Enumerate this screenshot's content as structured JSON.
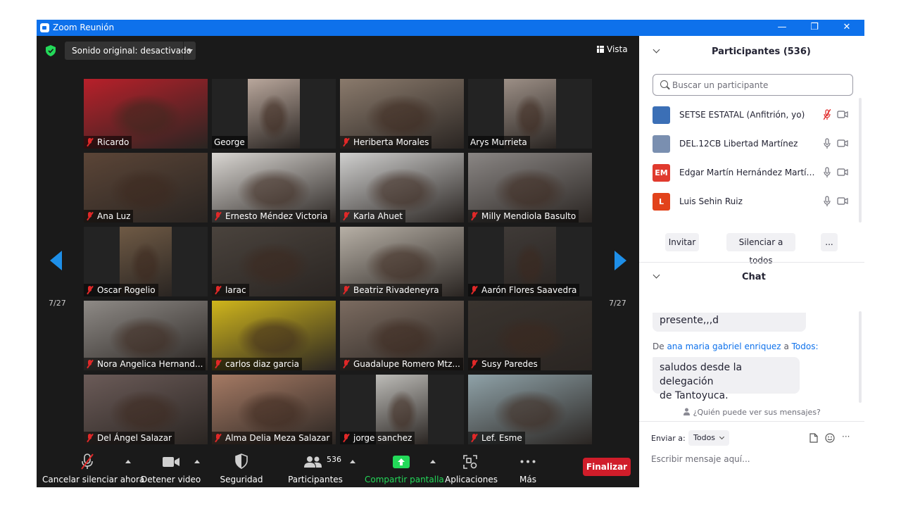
{
  "window": {
    "title": "Zoom Reunión",
    "minimize": "—",
    "maximize": "❐",
    "close": "✕"
  },
  "meeting": {
    "sound_label": "Sonido original: desactivado",
    "view_label": "Vista",
    "page_left": "7/27",
    "page_right": "7/27"
  },
  "tiles": [
    {
      "name": "Ricardo",
      "muted": true,
      "color": "#b8202a"
    },
    {
      "name": "George",
      "muted": false,
      "color": "#b9a79c"
    },
    {
      "name": "Heriberta Morales",
      "muted": true,
      "color": "#8a7a6c"
    },
    {
      "name": "Arys Murrieta",
      "muted": false,
      "color": "#9c8f86"
    },
    {
      "name": "Ana Luz",
      "muted": true,
      "color": "#5b4537"
    },
    {
      "name": "Ernesto Méndez Victoria",
      "muted": true,
      "color": "#d9d6d2"
    },
    {
      "name": "Karla Ahuet",
      "muted": true,
      "color": "#cfcfce"
    },
    {
      "name": "Milly Mendiola Basulto",
      "muted": true,
      "color": "#8a8684"
    },
    {
      "name": "Oscar Rogelio",
      "muted": true,
      "color": "#6f5a45"
    },
    {
      "name": "larac",
      "muted": true,
      "color": "#4a433d"
    },
    {
      "name": "Beatriz Rivadeneyra",
      "muted": true,
      "color": "#b7b0a6"
    },
    {
      "name": "Aarón Flores Saavedra",
      "muted": true,
      "color": "#3f3a37"
    },
    {
      "name": "Nora Angelica Hernand...",
      "muted": true,
      "color": "#8e8a86"
    },
    {
      "name": "carlos diaz garcia",
      "muted": true,
      "color": "#cfb51c"
    },
    {
      "name": "Guadalupe Romero Mtz...",
      "muted": true,
      "color": "#7b6b60"
    },
    {
      "name": "Susy Paredes",
      "muted": true,
      "color": "#3a342f"
    },
    {
      "name": "Del Ángel Salazar",
      "muted": true,
      "color": "#6b5b58"
    },
    {
      "name": "Alma Delia Meza Salazar",
      "muted": true,
      "color": "#a57a64"
    },
    {
      "name": "jorge sanchez",
      "muted": true,
      "color": "#bdbcb8"
    },
    {
      "name": "Lef. Esme",
      "muted": true,
      "color": "#8fa2a8"
    }
  ],
  "toolbar": {
    "mute_label": "Cancelar silenciar ahora",
    "video_label": "Detener video",
    "security_label": "Seguridad",
    "participants_label": "Participantes",
    "participants_count": "536",
    "share_label": "Compartir pantalla",
    "apps_label": "Aplicaciones",
    "more_label": "Más",
    "end_label": "Finalizar",
    "share_color": "#23d959"
  },
  "participants_panel": {
    "title": "Participantes (536)",
    "search_placeholder": "Buscar un participante",
    "list": [
      {
        "name": "SETSE ESTATAL (Anfitrión, yo)",
        "avatar": "",
        "avatar_color": "#3b6fb6",
        "mic_muted": true
      },
      {
        "name": "DEL.12CB Libertad Martínez",
        "avatar": "",
        "avatar_color": "#7a8fb0",
        "mic_muted": false
      },
      {
        "name": "Edgar Martín Hernández Martín...",
        "avatar": "EM",
        "avatar_color": "#e03a2e",
        "mic_muted": false
      },
      {
        "name": "Luis Sehin Ruiz",
        "avatar": "L",
        "avatar_color": "#e2421b",
        "mic_muted": false
      }
    ],
    "invite_label": "Invitar",
    "mute_all_label": "Silenciar a todos",
    "more_label": "..."
  },
  "chat": {
    "title": "Chat",
    "prev_message": "presente,,,d",
    "from_prefix": "De",
    "from_name": "ana maria gabriel enriquez",
    "to_word": "a",
    "to_name": "Todos:",
    "message_line1": "saludos desde la delegación",
    "message_line2": "de Tantoyuca.",
    "who_sees": "¿Quién puede ver sus mensajes?",
    "send_to_label": "Enviar a:",
    "send_to_value": "Todos",
    "input_placeholder": "Escribir mensaje aquí...",
    "more_label": "···"
  }
}
